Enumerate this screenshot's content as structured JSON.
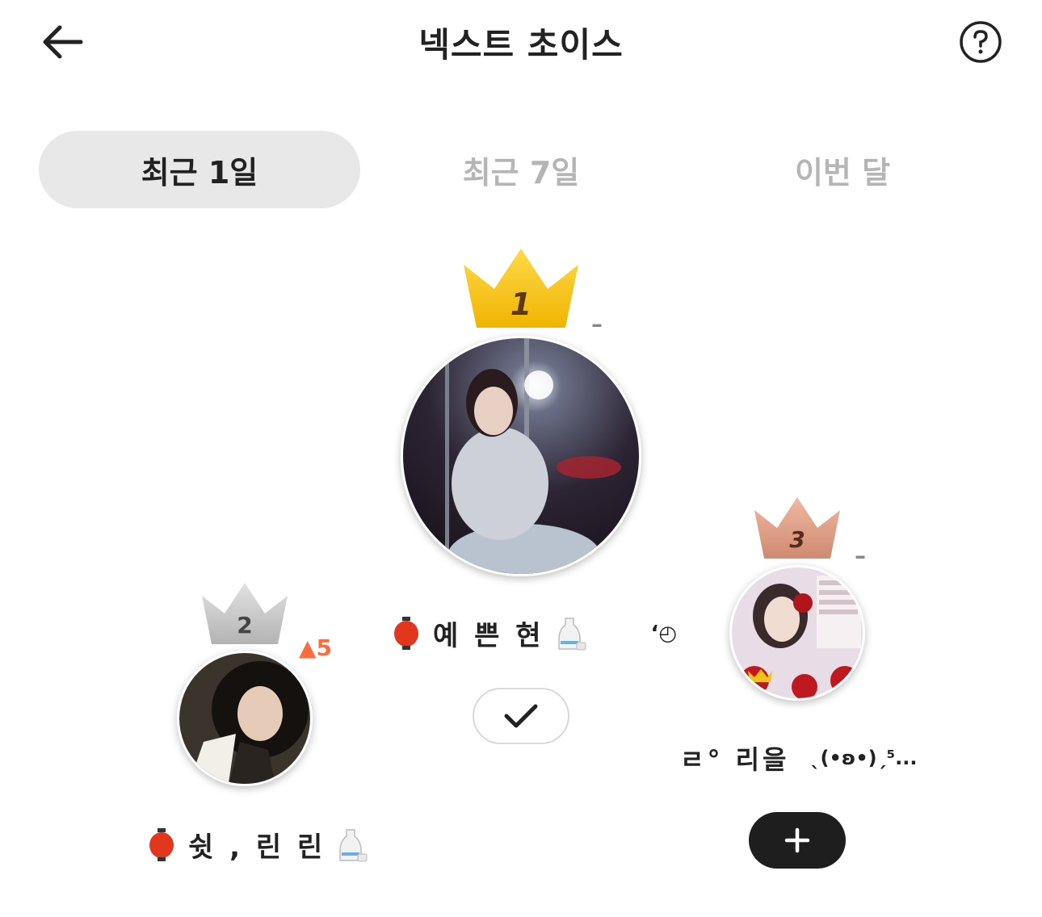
{
  "header": {
    "title": "넥스트 초이스",
    "back_icon": "arrow-left-icon",
    "help_icon": "question-circle-icon"
  },
  "tabs": [
    {
      "label": "최근 1일",
      "active": true
    },
    {
      "label": "최근 7일",
      "active": false
    },
    {
      "label": "이번 달",
      "active": false
    }
  ],
  "ranking": {
    "first": {
      "rank": "1",
      "change": "–",
      "name": "예 쁜 현",
      "suffix": "‘◴",
      "crown_color": "#f2c21a",
      "action_icon": "check-icon"
    },
    "second": {
      "rank": "2",
      "change": "▲5",
      "change_color": "#ff6b3d",
      "name": "쉿 , 린 린",
      "crown_color": "#c4c4c4"
    },
    "third": {
      "rank": "3",
      "change": "–",
      "name": "ㄹ° 리을",
      "suffix": "ˎ(•ʚ•)ˏ⁵...",
      "crown_color": "#d4907a",
      "action_icon": "plus-icon"
    }
  }
}
